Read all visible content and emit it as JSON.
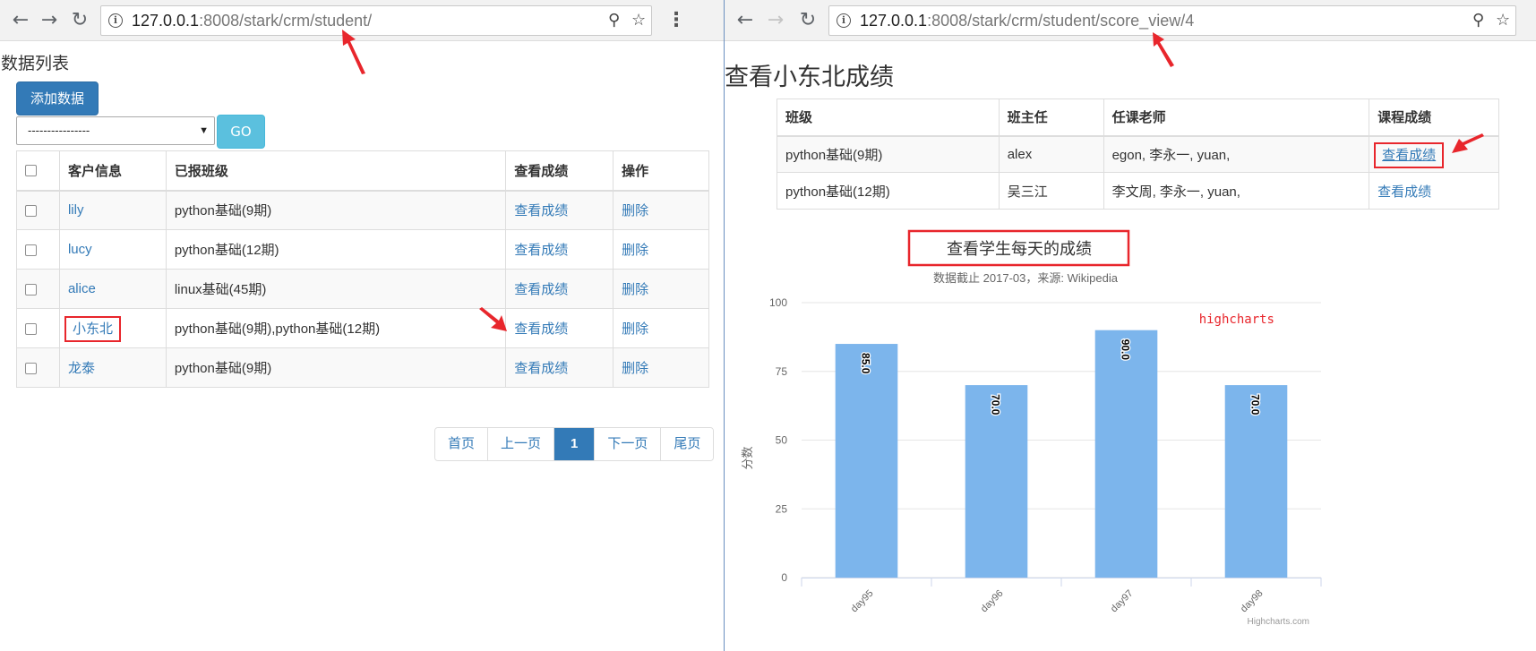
{
  "left": {
    "url": {
      "host": "127.0.0.1",
      "rest": ":8008/stark/crm/student/"
    },
    "heading": "数据列表",
    "add_button": "添加数据",
    "filter": {
      "selected": "----------------",
      "go_label": "GO"
    },
    "table": {
      "headers": [
        "客户信息",
        "已报班级",
        "查看成绩",
        "操作"
      ],
      "rows": [
        {
          "name": "lily",
          "classes": "python基础(9期)",
          "score": "查看成绩",
          "action": "删除"
        },
        {
          "name": "lucy",
          "classes": "python基础(12期)",
          "score": "查看成绩",
          "action": "删除"
        },
        {
          "name": "alice",
          "classes": "linux基础(45期)",
          "score": "查看成绩",
          "action": "删除"
        },
        {
          "name": "小东北",
          "classes": "python基础(9期),python基础(12期)",
          "score": "查看成绩",
          "action": "删除"
        },
        {
          "name": "龙泰",
          "classes": "python基础(9期)",
          "score": "查看成绩",
          "action": "删除"
        }
      ]
    },
    "pagination": {
      "first": "首页",
      "prev": "上一页",
      "current": "1",
      "next": "下一页",
      "last": "尾页"
    }
  },
  "right": {
    "url": {
      "host": "127.0.0.1",
      "rest": ":8008/stark/crm/student/score_view/4"
    },
    "heading": "查看小东北成绩",
    "table": {
      "headers": [
        "班级",
        "班主任",
        "任课老师",
        "课程成绩"
      ],
      "rows": [
        {
          "class": "python基础(9期)",
          "head_teacher": "alex",
          "teachers": "egon, 李永一, yuan,",
          "score": "查看成绩"
        },
        {
          "class": "python基础(12期)",
          "head_teacher": "吴三江",
          "teachers": "李文周, 李永一, yuan,",
          "score": "查看成绩"
        }
      ]
    }
  },
  "chart_data": {
    "type": "bar",
    "title": "查看学生每天的成绩",
    "subtitle": "数据截止 2017-03，来源: Wikipedia",
    "categories": [
      "day95",
      "day96",
      "day97",
      "day98"
    ],
    "values": [
      85.0,
      70.0,
      90.0,
      70.0
    ],
    "data_labels": [
      "85.0",
      "70.0",
      "90.0",
      "70.0"
    ],
    "ylabel": "分数",
    "ylim": [
      0,
      100
    ],
    "yticks": [
      0,
      25,
      50,
      75,
      100
    ],
    "annotation": "highcharts",
    "credits": "Highcharts.com",
    "bar_color": "#7cb5ec",
    "grid": true
  },
  "colors": {
    "link": "#337ab7",
    "primary": "#337ab7",
    "info": "#5bc0de",
    "highlight": "#e8262c"
  }
}
